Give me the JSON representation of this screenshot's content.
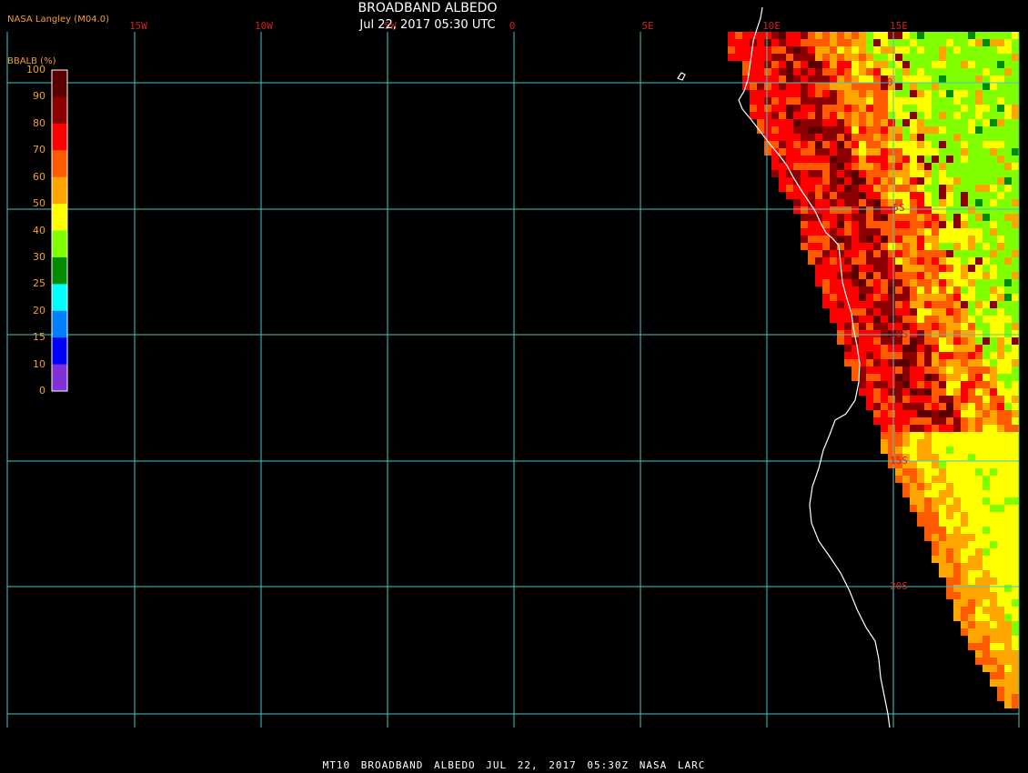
{
  "header": {
    "credit": "NASA Langley (M04.0)",
    "title": "BROADBAND ALBEDO",
    "subtitle": "Jul 22, 2017 05:30 UTC"
  },
  "colorbar": {
    "title": "BBALB (%)",
    "ticks": [
      "100",
      "90",
      "80",
      "70",
      "60",
      "50",
      "40",
      "30",
      "25",
      "20",
      "15",
      "10",
      "0"
    ],
    "colors": [
      "#5a0000",
      "#8b0000",
      "#ff0000",
      "#ff5a00",
      "#ffa500",
      "#ffff00",
      "#80ff00",
      "#008b00",
      "#00ffff",
      "#0080ff",
      "#0000ff",
      "#8030d8"
    ]
  },
  "grid": {
    "line_color": "#3fc8c8",
    "label_color": "#d02020",
    "lon_labels": [
      "15W",
      "10W",
      "5W",
      "0",
      "5E",
      "10E",
      "15E"
    ],
    "lat_labels": [
      "0",
      "5S",
      "10S",
      "15S",
      "20S"
    ]
  },
  "footer": {
    "text": "MT10  BROADBAND ALBEDO   JUL 22, 2017 05:30Z   NASA LARC"
  },
  "icons": {
    "coastline": "coastline-outline",
    "island": "island-outline"
  }
}
